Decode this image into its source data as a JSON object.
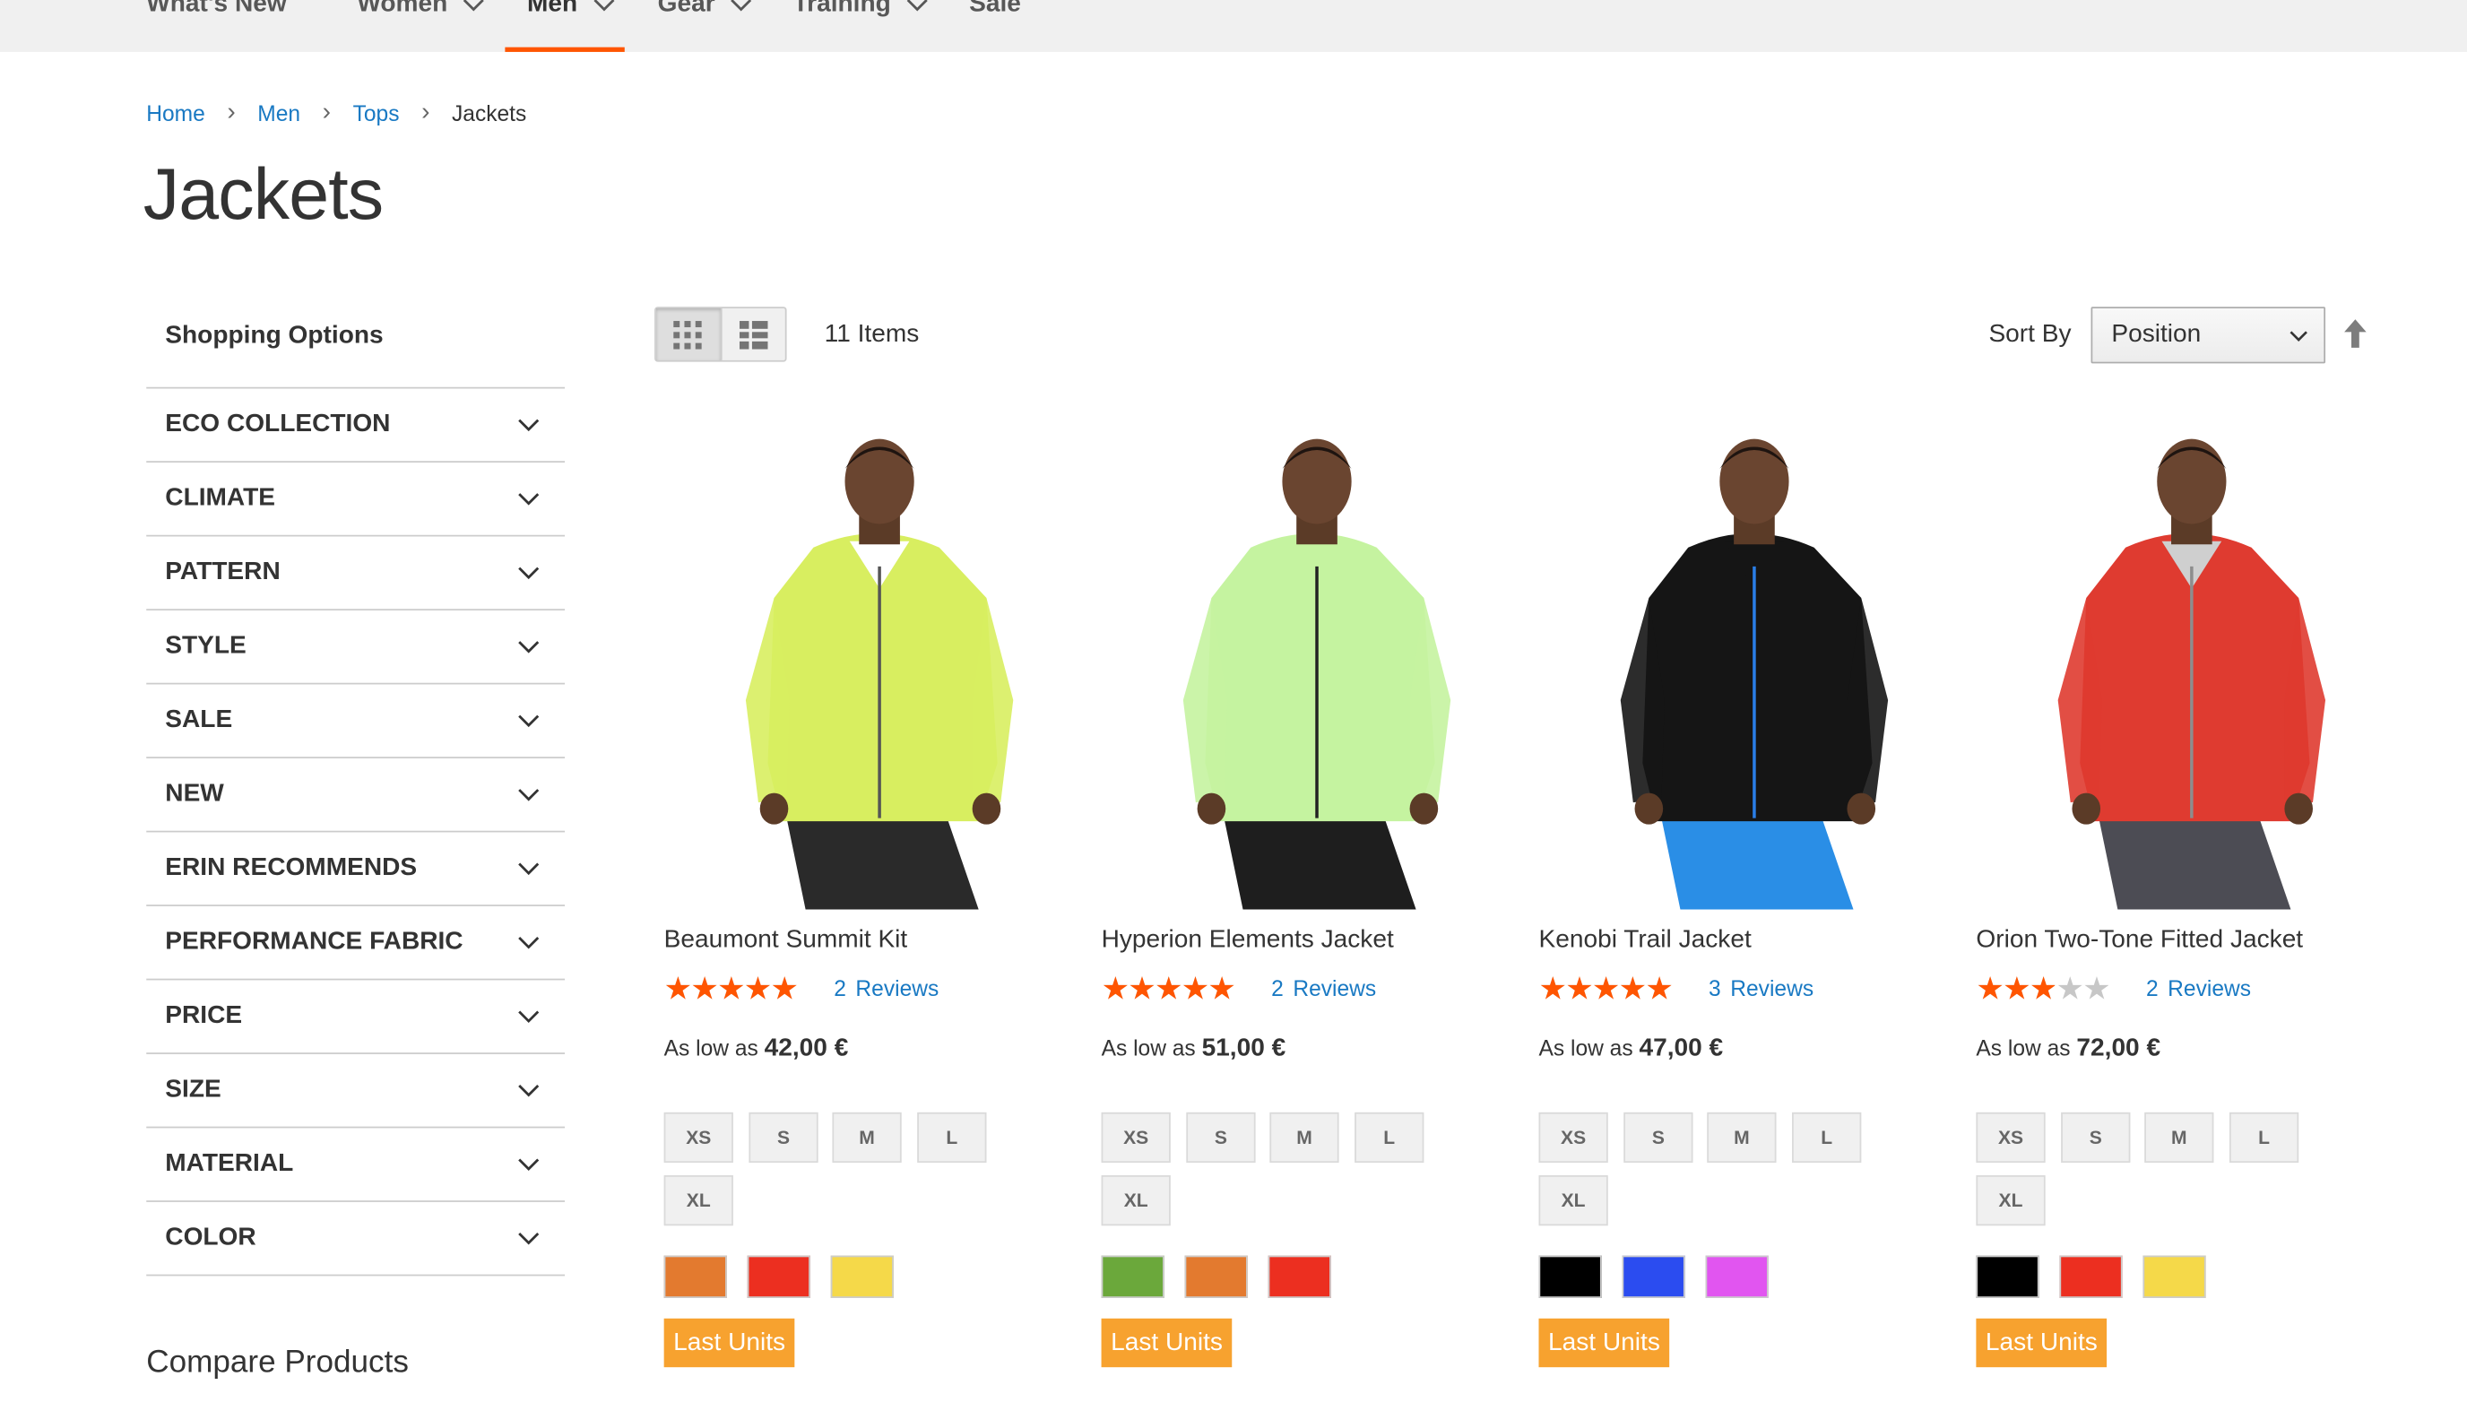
{
  "nav": {
    "items": [
      {
        "label": "What's New",
        "has_menu": false,
        "active": false
      },
      {
        "label": "Women",
        "has_menu": true,
        "active": false
      },
      {
        "label": "Men",
        "has_menu": true,
        "active": true
      },
      {
        "label": "Gear",
        "has_menu": true,
        "active": false
      },
      {
        "label": "Training",
        "has_menu": true,
        "active": false
      },
      {
        "label": "Sale",
        "has_menu": false,
        "active": false
      }
    ],
    "active_color": "#ff5501"
  },
  "breadcrumbs": [
    "Home",
    "Men",
    "Tops",
    "Jackets"
  ],
  "page_title": "Jackets",
  "sidebar": {
    "title": "Shopping Options",
    "filters": [
      "ECO COLLECTION",
      "CLIMATE",
      "PATTERN",
      "STYLE",
      "SALE",
      "NEW",
      "ERIN RECOMMENDS",
      "PERFORMANCE FABRIC",
      "PRICE",
      "SIZE",
      "MATERIAL",
      "COLOR"
    ],
    "compare_title": "Compare Products"
  },
  "toolbar": {
    "view_modes": [
      {
        "name": "grid-view-icon",
        "active": true
      },
      {
        "name": "list-view-icon",
        "active": false
      }
    ],
    "items_count": "11 Items",
    "sort_label": "Sort By",
    "sort_value": "Position",
    "sort_direction_icon": "arrow-up-icon"
  },
  "products": [
    {
      "name": "Beaumont Summit Kit",
      "rating_percent": 87,
      "reviews_count": "2",
      "reviews_label": "Reviews",
      "price_prefix": "As low as",
      "price": "42,00 €",
      "sizes": [
        "XS",
        "S",
        "M",
        "L",
        "XL"
      ],
      "colors": [
        "#e37a2f",
        "#ec2f20",
        "#f5d949"
      ],
      "badge": "Last Units",
      "image": {
        "jacket": "#d8ee60",
        "pants": "#2a2a2a",
        "shirt": "#ffffff",
        "accent": "#555555"
      }
    },
    {
      "name": "Hyperion Elements Jacket",
      "rating_percent": 87,
      "reviews_count": "2",
      "reviews_label": "Reviews",
      "price_prefix": "As low as",
      "price": "51,00 €",
      "sizes": [
        "XS",
        "S",
        "M",
        "L",
        "XL"
      ],
      "colors": [
        "#6ba83b",
        "#e37a2f",
        "#ec2f20"
      ],
      "badge": "Last Units",
      "image": {
        "jacket": "#c5f3a0",
        "pants": "#1e1e1e",
        "shirt": "#c5f3a0",
        "accent": "#222222"
      }
    },
    {
      "name": "Kenobi Trail Jacket",
      "rating_percent": 93,
      "reviews_count": "3",
      "reviews_label": "Reviews",
      "price_prefix": "As low as",
      "price": "47,00 €",
      "sizes": [
        "XS",
        "S",
        "M",
        "L",
        "XL"
      ],
      "colors": [
        "#000000",
        "#2b4cf0",
        "#e155f0"
      ],
      "badge": "Last Units",
      "image": {
        "jacket": "#151515",
        "pants": "#2a8ee6",
        "shirt": "#151515",
        "accent": "#2a7ee6"
      }
    },
    {
      "name": "Orion Two-Tone Fitted Jacket",
      "rating_percent": 50,
      "reviews_count": "2",
      "reviews_label": "Reviews",
      "price_prefix": "As low as",
      "price": "72,00 €",
      "sizes": [
        "XS",
        "S",
        "M",
        "L",
        "XL"
      ],
      "colors": [
        "#000000",
        "#ec2f20",
        "#f5d949"
      ],
      "badge": "Last Units",
      "image": {
        "jacket": "#df3b30",
        "pants": "#4c4c54",
        "shirt": "#cfcfcf",
        "accent": "#8d8d8d"
      }
    }
  ]
}
